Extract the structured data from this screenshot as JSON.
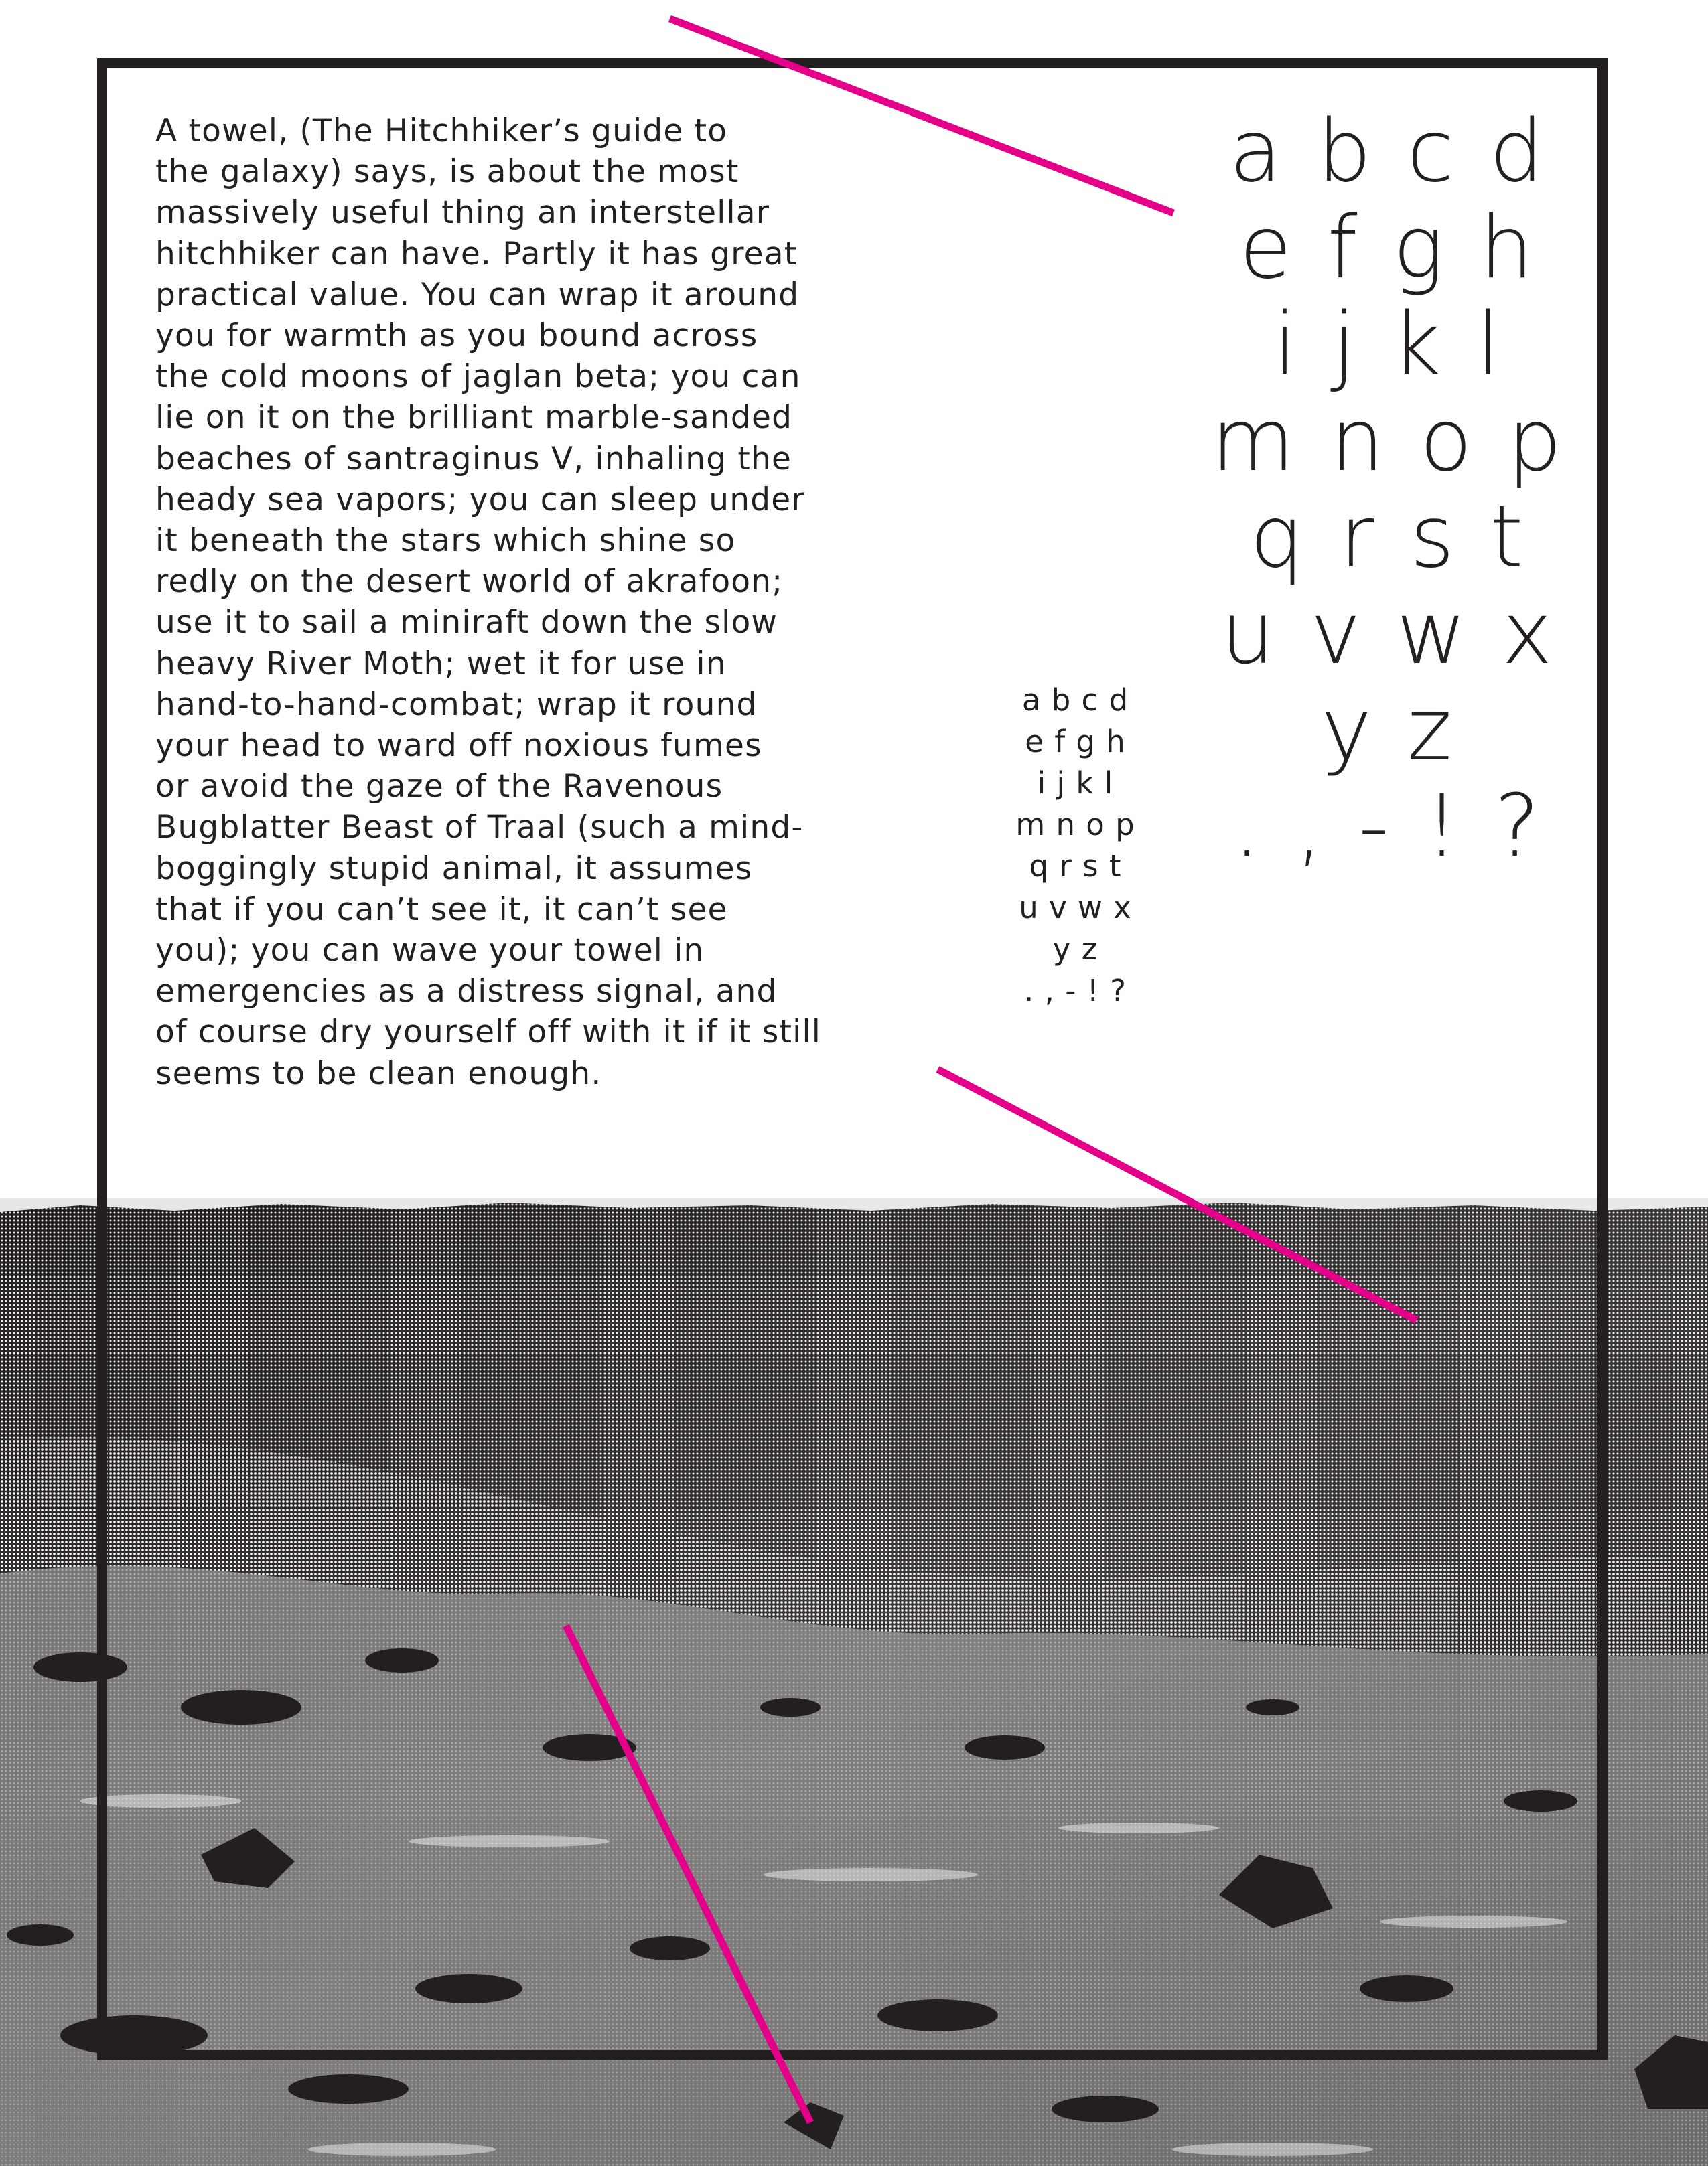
{
  "colors": {
    "ink": "#231f20",
    "accent": "#e5008a",
    "paper": "#ffffff"
  },
  "body_text": {
    "lines": [
      "A towel, (The Hitchhiker’s guide to",
      "the galaxy)  says, is about the most",
      "massively useful thing an interstellar",
      "hitchhiker can have. Partly it has great",
      "practical value. You can wrap it around",
      "you for warmth as you bound across",
      "the cold moons of jaglan beta; you can",
      "lie on it on the brilliant marble-sanded",
      "beaches of santraginus V, inhaling the",
      "heady sea vapors; you can sleep under",
      "it beneath the stars which shine so",
      "redly on the desert world of   akrafoon;",
      "use it to sail a miniraft down the slow",
      "heavy River Moth; wet it for use in",
      "hand-to-hand-combat; wrap it round",
      "your head to ward off noxious fumes",
      "or avoid the gaze of the Ravenous",
      "Bugblatter Beast of Traal (such a mind-",
      "boggingly stupid animal, it assumes",
      "that if you can’t see it, it can’t see",
      "you); you can wave your towel in",
      "emergencies as a distress signal, and",
      "of course dry yourself off with it if it still",
      "seems to be clean enough."
    ]
  },
  "specimen_large": {
    "rows": [
      "a b c d",
      "e f g h",
      "i j k l",
      "m n o p",
      "q r s t",
      "u v w x",
      "y z",
      ". , - ! ?"
    ]
  },
  "specimen_small": {
    "rows": [
      "a b c d",
      "e f g h",
      "i j k l",
      "m n o p",
      "q r s t",
      "u v w x",
      "y z",
      ". , - ! ?"
    ]
  }
}
